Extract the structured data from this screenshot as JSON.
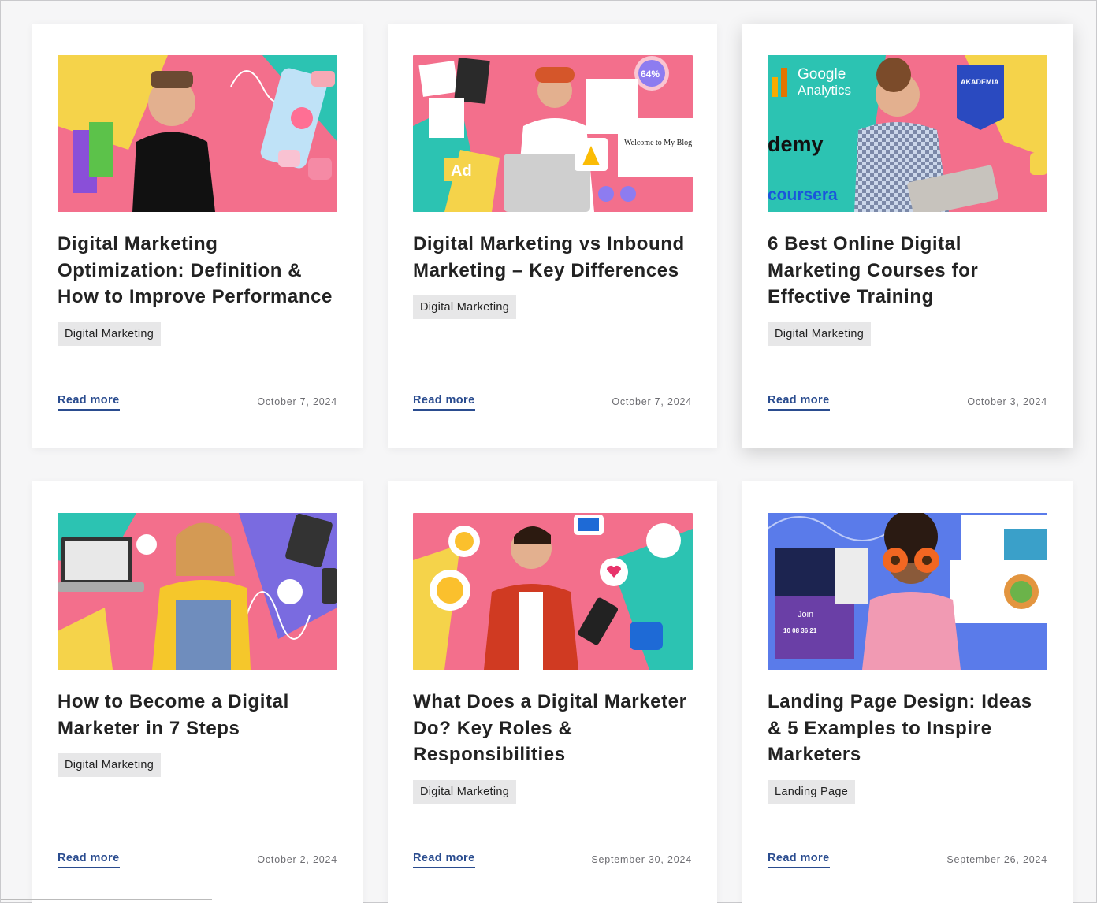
{
  "posts": [
    {
      "title": "Digital Marketing Optimization: Definition & How to Improve Performance",
      "tag": "Digital Marketing",
      "read_more": "Read more",
      "date": "October 7, 2024",
      "colors": {
        "bg": "#f36f8c",
        "accent1": "#f5d34a",
        "accent2": "#2cc3b2"
      }
    },
    {
      "title": "Digital Marketing vs Inbound Marketing – Key Differences",
      "tag": "Digital Marketing",
      "read_more": "Read more",
      "date": "October 7, 2024",
      "badge_text": "64%",
      "ad_text": "Ad",
      "blog_text": "Welcome to My Blog",
      "colors": {
        "bg": "#f36f8c",
        "accent1": "#2cc3b2",
        "accent2": "#f5d34a"
      }
    },
    {
      "title": "6 Best Online Digital Marketing Courses for Effective Training",
      "tag": "Digital Marketing",
      "read_more": "Read more",
      "date": "October 3, 2024",
      "logo_texts": [
        "Google",
        "Analytics",
        "demy",
        "coursera",
        "AKADEMIA"
      ],
      "colors": {
        "bg": "#f36f8c",
        "accent1": "#2cc3b2",
        "accent2": "#f5d34a"
      }
    },
    {
      "title": "How to Become a Digital Marketer in 7 Steps",
      "tag": "Digital Marketing",
      "read_more": "Read more",
      "date": "October 2, 2024",
      "colors": {
        "bg": "#f36f8c",
        "accent1": "#7a6be0",
        "accent2": "#2cc3b2"
      }
    },
    {
      "title": "What Does a Digital Marketer Do? Key Roles & Responsibilities",
      "tag": "Digital Marketing",
      "read_more": "Read more",
      "date": "September 30, 2024",
      "colors": {
        "bg": "#f36f8c",
        "accent1": "#2cc3b2",
        "accent2": "#f5d34a"
      }
    },
    {
      "title": "Landing Page Design: Ideas & 5 Examples to Inspire Marketers",
      "tag": "Landing Page",
      "read_more": "Read more",
      "date": "September 26, 2024",
      "join_text": "Join",
      "countdown": "10  08  36  21",
      "colors": {
        "bg": "#5a7bea",
        "accent1": "#f36f8c",
        "accent2": "#2cc3b2"
      }
    }
  ]
}
